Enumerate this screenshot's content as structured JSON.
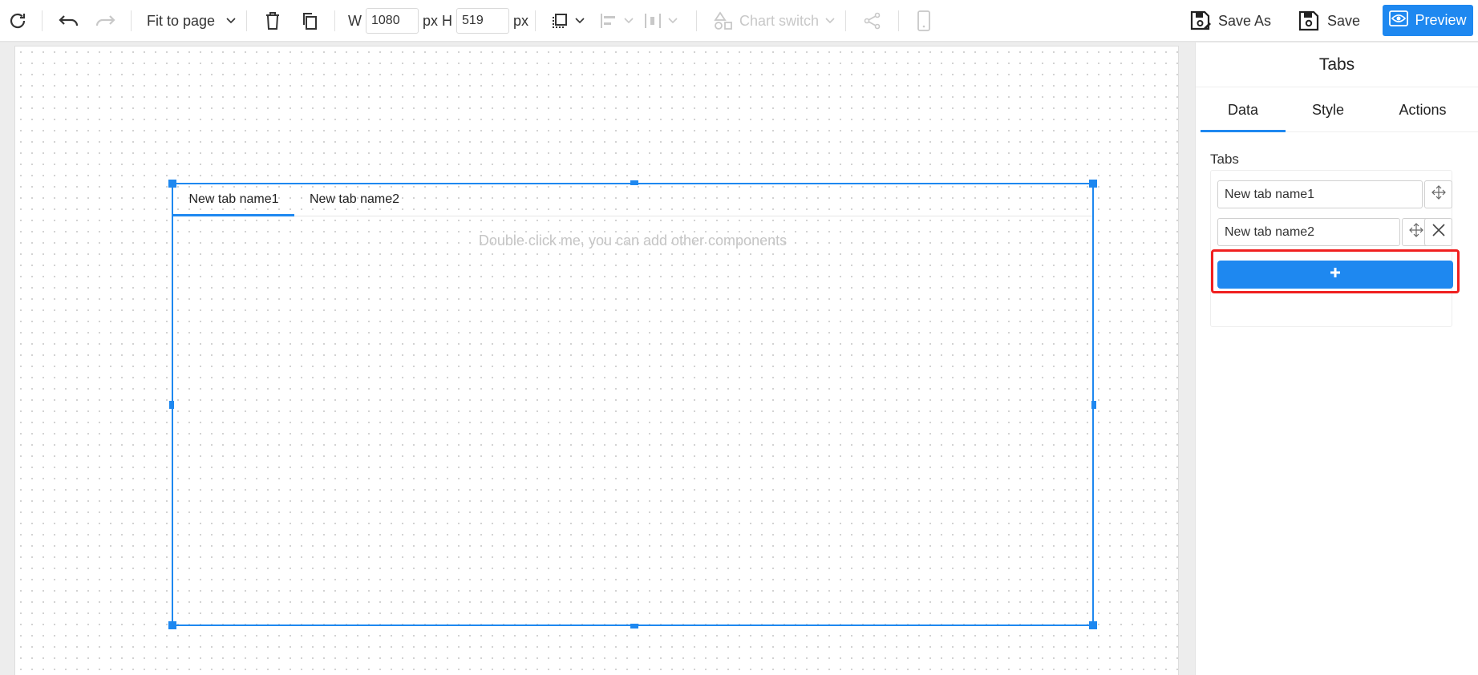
{
  "toolbar": {
    "refresh_icon": "refresh-icon",
    "undo_icon": "undo-icon",
    "redo_icon": "redo-icon",
    "zoom_label": "Fit to page",
    "delete_icon": "trash-icon",
    "copy_icon": "copy-icon",
    "width_label": "W",
    "width_value": "1080",
    "width_unit": "px",
    "height_label": "H",
    "height_value": "519",
    "height_unit": "px",
    "chart_switch_label": "Chart switch",
    "save_as_label": "Save As",
    "save_label": "Save",
    "preview_label": "Preview"
  },
  "canvas": {
    "tabs": [
      {
        "label": "New tab name1",
        "active": true
      },
      {
        "label": "New tab name2",
        "active": false
      }
    ],
    "placeholder": "Double click me, you can add other components"
  },
  "panel": {
    "title": "Tabs",
    "tabs": [
      {
        "label": "Data",
        "active": true
      },
      {
        "label": "Style",
        "active": false
      },
      {
        "label": "Actions",
        "active": false
      }
    ],
    "section_label": "Tabs",
    "tab_items": [
      {
        "value": "New tab name1"
      },
      {
        "value": "New tab name2"
      }
    ],
    "add_button_icon": "plus-icon"
  },
  "colors": {
    "accent": "#1e88f0",
    "highlight": "#f02020"
  }
}
